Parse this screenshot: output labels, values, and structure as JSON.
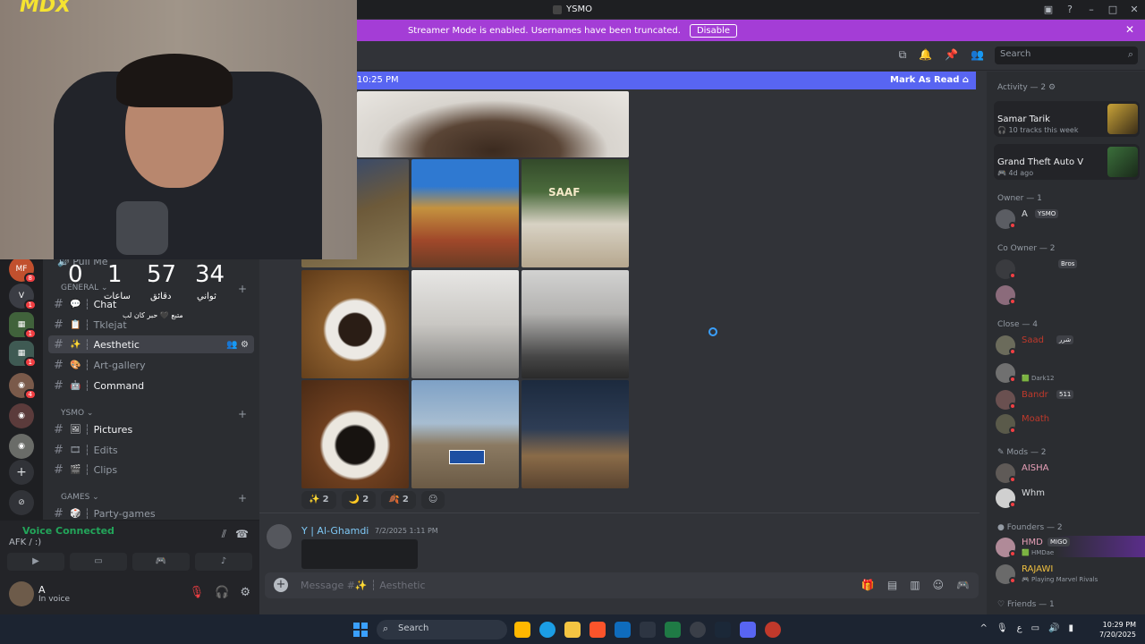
{
  "window": {
    "title": "YSMO"
  },
  "banner": {
    "text": "Streamer Mode is enabled. Usernames have been truncated.",
    "button": "Disable"
  },
  "header": {
    "search_placeholder": "Search"
  },
  "webcam": {
    "logo": "MDX"
  },
  "timer": {
    "values": [
      "0",
      "1",
      "57",
      "34"
    ],
    "labels": [
      "ساعات",
      "دقائق",
      "ثواني"
    ],
    "note": "متبع 🖤 حبر كان لب"
  },
  "sidebar": {
    "pull": "Pull Me",
    "categories": {
      "general": "GENERAL",
      "ysmo": "YSMO",
      "games": "GAMES"
    },
    "channels": {
      "chat": "Chat",
      "tklejat": "Tklejat",
      "aesthetic": "Aesthetic",
      "art_gallery": "Art-gallery",
      "command": "Command",
      "pictures": "Pictures",
      "edits": "Edits",
      "clips": "Clips",
      "party_games": "Party-games"
    }
  },
  "voice": {
    "status": "Voice Connected",
    "channel": "AFK / :)"
  },
  "user": {
    "name": "A",
    "status": "In voice"
  },
  "chat": {
    "new_bar_time": "10:25 PM",
    "mark_read": "Mark As Read",
    "reactions": [
      "2",
      "2",
      "2"
    ],
    "msg2_author": "Y | Al-Ghamdi",
    "msg2_time": "7/2/2025 1:11 PM",
    "composer_placeholder": "Message #✨ ┆ Aesthetic"
  },
  "members": {
    "activity_header": "Activity — 2",
    "cards": [
      {
        "name": "Samar Tarik",
        "sub": "10 tracks this week"
      },
      {
        "name": "Grand Theft Auto V",
        "sub": "4d ago"
      }
    ],
    "groups": {
      "owner": "Owner — 1",
      "coowner": "Co Owner — 2",
      "close": "Close — 4",
      "mods": "Mods — 2",
      "founders": "Founders — 2",
      "friends": "Friends — 1"
    },
    "owner_name": "A",
    "owner_tag": "YSMO",
    "coowner_tag": "Bros",
    "close": [
      {
        "name": "Saad",
        "tag": "شرر"
      },
      {
        "name": "",
        "status": "Dark12"
      },
      {
        "name": "Bandr",
        "tag": "511"
      },
      {
        "name": "Moath"
      }
    ],
    "mods": [
      "AISHA",
      "Whm"
    ],
    "founders": [
      {
        "name": "HMD",
        "tag": "MIGO",
        "status": "HMDae"
      },
      {
        "name": "RAJAWI",
        "status": "Playing Marvel Rivals"
      }
    ]
  },
  "taskbar": {
    "search": "Search",
    "time": "10:29 PM",
    "date": "7/20/2025"
  },
  "colors": {
    "blurple": "#5865f2",
    "banner": "#a43dd6",
    "online": "#23a55a",
    "dnd": "#f23f43"
  }
}
